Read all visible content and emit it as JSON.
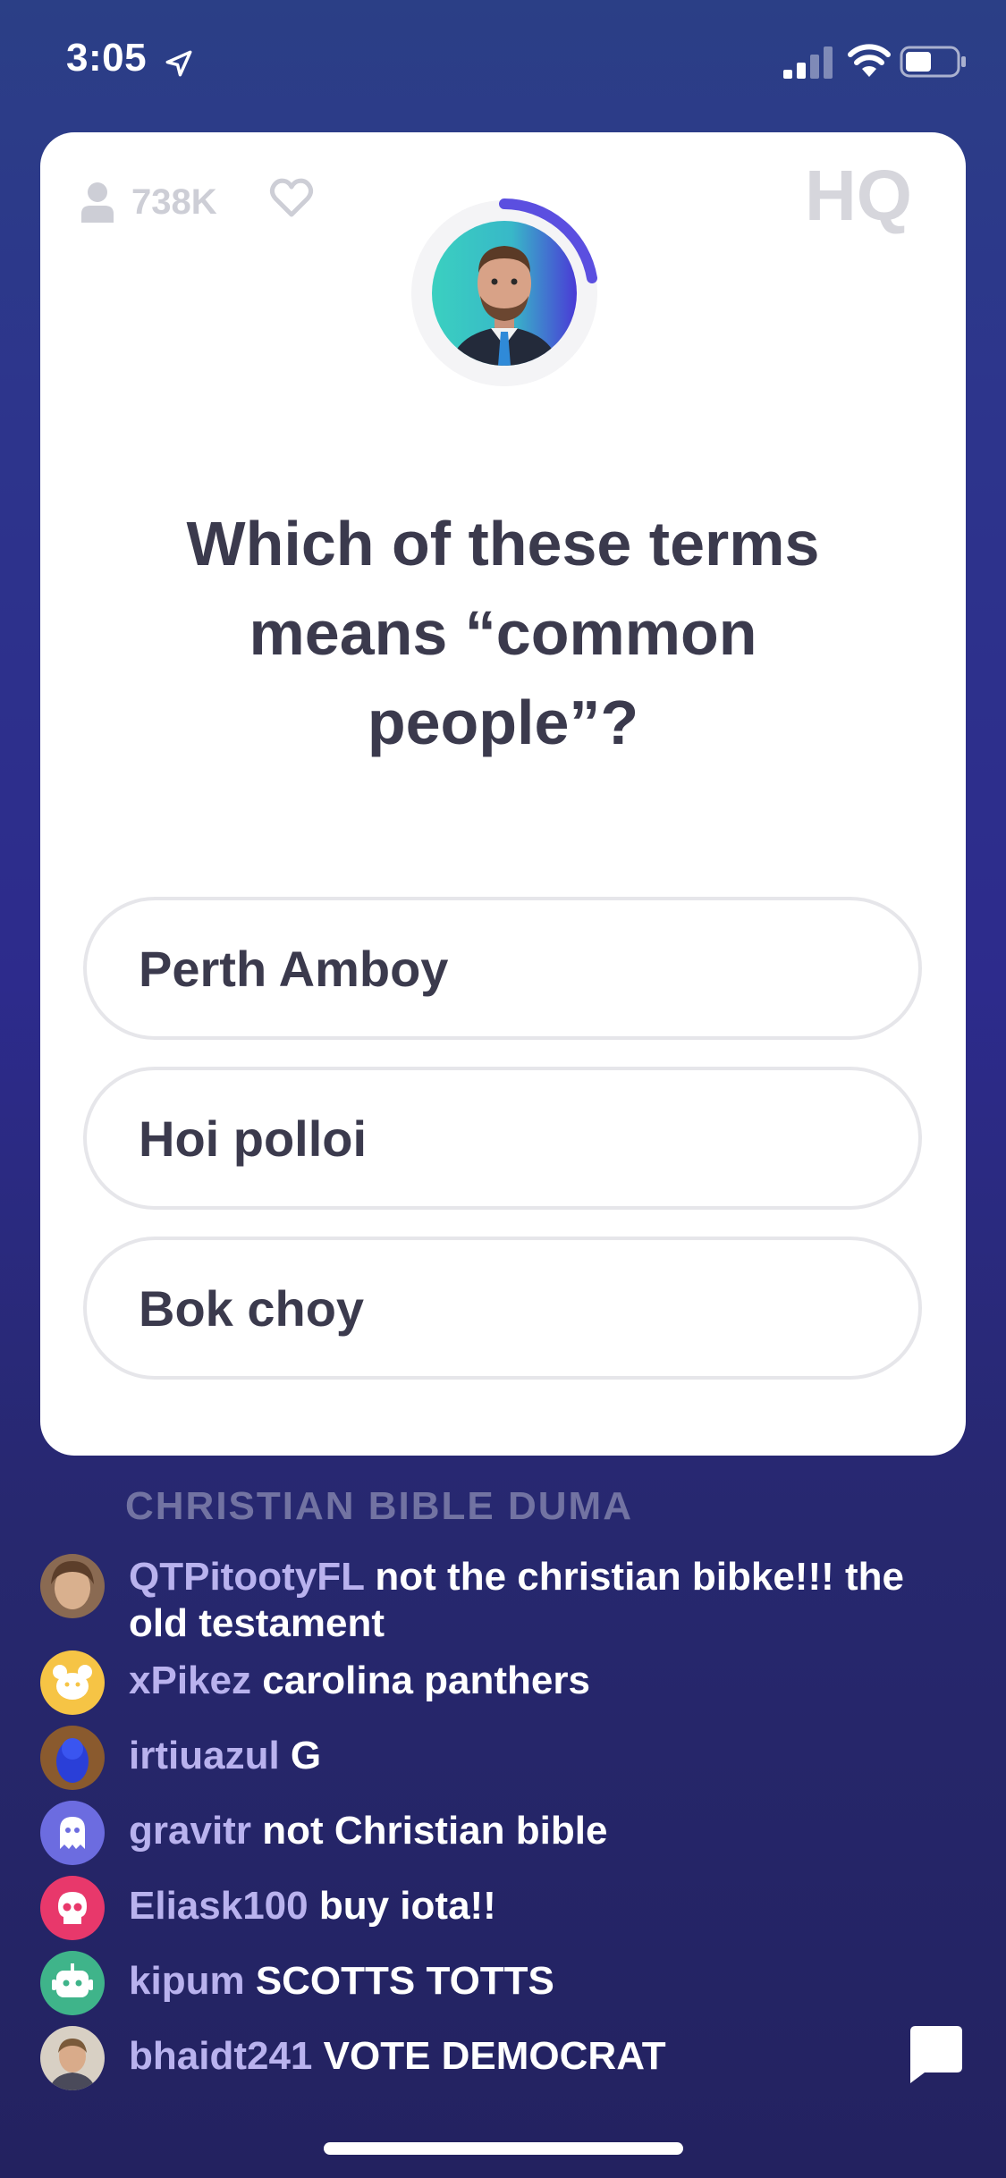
{
  "status_bar": {
    "time": "3:05",
    "icons": [
      "location-arrow-icon",
      "cellular-signal-icon",
      "wifi-icon",
      "battery-icon"
    ]
  },
  "game": {
    "viewers": "738K",
    "logo": "HQ",
    "question": "Which of these terms means “common people”?",
    "answers": [
      "Perth Amboy",
      "Hoi polloi",
      "Bok choy"
    ],
    "accent_color": "#5b4fe0"
  },
  "chat": {
    "faded_message": "CHRISTIAN BIBLE DUMA",
    "messages": [
      {
        "user": "QTPitootyFL",
        "text": "not the christian bibke!!! the old testament",
        "avatar": "photo-avatar"
      },
      {
        "user": "xPikez",
        "text": "carolina panthers",
        "avatar": "bear-avatar",
        "color": "#f6c445"
      },
      {
        "user": "irtiuazul",
        "text": "G",
        "avatar": "photo-avatar"
      },
      {
        "user": "gravitr",
        "text": "not Christian bible",
        "avatar": "ghost-avatar",
        "color": "#6c6ce0"
      },
      {
        "user": "Eliask100",
        "text": "buy iota!!",
        "avatar": "skull-avatar",
        "color": "#e8386b"
      },
      {
        "user": "kipum",
        "text": "SCOTTS TOTTS",
        "avatar": "robot-avatar",
        "color": "#3fb48a"
      },
      {
        "user": "bhaidt241",
        "text": "VOTE DEMOCRAT",
        "avatar": "photo-avatar"
      }
    ]
  }
}
